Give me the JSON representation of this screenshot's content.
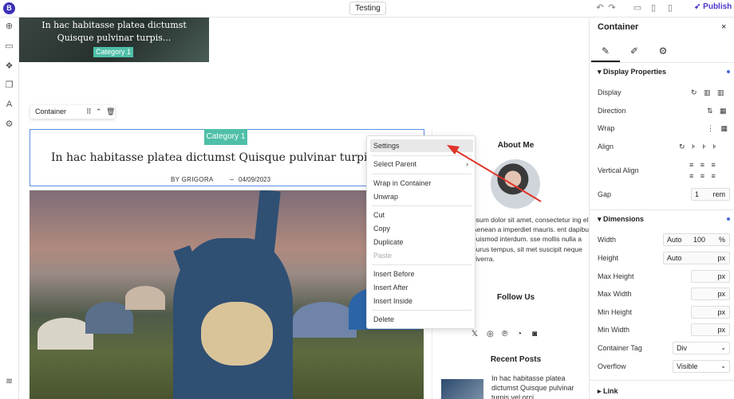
{
  "toolbar": {
    "logo_letter": "B",
    "page_name": "Testing",
    "publish_label": "Publish",
    "icons": [
      "undo-icon",
      "redo-icon",
      "desktop-icon",
      "tablet-icon",
      "mobile-icon",
      "rocket-icon"
    ]
  },
  "left_sidebar": {
    "icons": [
      "add-icon",
      "layout-icon",
      "components-icon",
      "pages-icon",
      "typography-icon",
      "settings-icon",
      "layers-icon"
    ]
  },
  "canvas": {
    "hero_card": {
      "title": "In hac habitasse platea dictumst Quisque pulvinar turpis...",
      "category": "Category 1"
    },
    "container_label": "Container",
    "post": {
      "category": "Category 1",
      "title": "In hac habitasse platea dictumst Quisque pulvinar turpis vel",
      "byline": "BY GRIGORA",
      "separator": "–",
      "date": "04/09/2023"
    },
    "sidebar": {
      "about_heading": "About Me",
      "about_text": "psum dolor sit amet, consectetur ing elit. Aenean a imperdiet mauris. ent dapibus euismod interdum. sse mollis nulla a purus tempus, sit met suscipit neque viverra.",
      "follow_heading": "Follow Us",
      "social_icons": [
        "x-icon",
        "instagram-icon",
        "pinterest-icon",
        "messenger-icon",
        "discord-icon"
      ],
      "social_glyphs": [
        "𝕏",
        "◎",
        "℗",
        "◔",
        "◙"
      ],
      "recent_heading": "Recent Posts",
      "recent_post_title": "In hac habitasse platea dictumst Quisque pulvinar turpis vel orci"
    }
  },
  "context_menu": {
    "items": [
      {
        "label": "Settings",
        "hover": true
      },
      {
        "label": "Select Parent",
        "submenu": true
      },
      {
        "label": "Wrap in Container"
      },
      {
        "label": "Unwrap"
      },
      {
        "label": "Cut"
      },
      {
        "label": "Copy"
      },
      {
        "label": "Duplicate"
      },
      {
        "label": "Paste",
        "disabled": true
      },
      {
        "label": "Insert Before"
      },
      {
        "label": "Insert After"
      },
      {
        "label": "Insert Inside"
      },
      {
        "label": "Delete"
      }
    ]
  },
  "panel": {
    "title": "Container",
    "close": "×",
    "display_properties": {
      "heading": "Display Properties",
      "rows": [
        {
          "label": "Display"
        },
        {
          "label": "Direction"
        },
        {
          "label": "Wrap"
        },
        {
          "label": "Align"
        },
        {
          "label": "Vertical Align"
        },
        {
          "label": "Gap",
          "value": "1",
          "unit": "rem"
        }
      ]
    },
    "dimensions": {
      "heading": "Dimensions",
      "width_label": "Width",
      "width_mode": "Auto",
      "width_value": "100",
      "width_unit": "%",
      "height_label": "Height",
      "height_mode": "Auto",
      "height_unit": "px",
      "max_height_label": "Max Height",
      "max_width_label": "Max Width",
      "min_height_label": "Min Height",
      "min_width_label": "Min Width",
      "unit_px": "px",
      "tag_label": "Container Tag",
      "tag_value": "Div",
      "overflow_label": "Overflow",
      "overflow_value": "Visible"
    },
    "link_heading": "Link"
  },
  "colors": {
    "accent": "#4a35c7",
    "category_tag": "#4fbfa8",
    "selection_border": "#5b8de0",
    "arrow": "#e0342b"
  }
}
